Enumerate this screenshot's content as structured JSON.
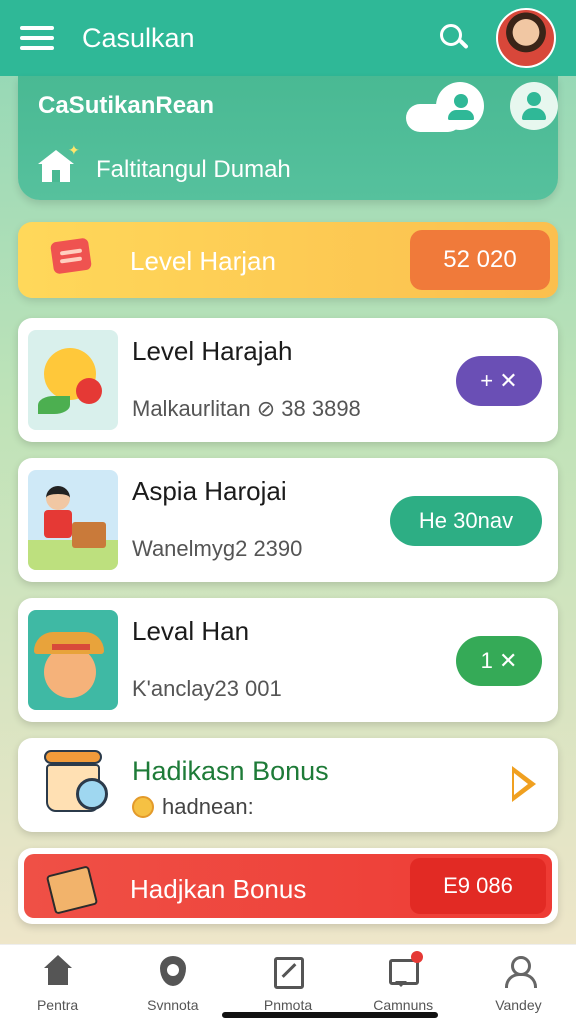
{
  "app": {
    "title": "Casulkan"
  },
  "header": {
    "title": "CaSutikanRean",
    "subtitle": "Faltitangul Dumah"
  },
  "level_banner": {
    "label": "Level Harjan",
    "value": "52 020"
  },
  "cards": [
    {
      "title": "Level Harajah",
      "subtitle": "Malkaurlitan ⊘ 38 3898",
      "action_label": "+ ✕",
      "action_color": "#6a4fb5"
    },
    {
      "title": "Aspia Harojai",
      "subtitle": "Wanelmyg2 2390",
      "action_label": "He 30nav",
      "action_color": "#2dae84"
    },
    {
      "title": "Leval Han",
      "subtitle": "K'anclay23 001",
      "action_label": "1 ✕",
      "action_color": "#35aa57"
    }
  ],
  "bonus_card": {
    "title": "Hadikasn Bonus",
    "subtitle": "hadnean:"
  },
  "red_banner": {
    "label": "Hadjkan Bonus",
    "value": "E9 086"
  },
  "bottom_nav": [
    {
      "label": "Pentra",
      "icon": "home-icon"
    },
    {
      "label": "Svnnota",
      "icon": "shield-icon"
    },
    {
      "label": "Pnmota",
      "icon": "edit-icon"
    },
    {
      "label": "Camnuns",
      "icon": "chat-icon"
    },
    {
      "label": "Vandey",
      "icon": "user-icon"
    }
  ],
  "colors": {
    "primary": "#2fb897",
    "accent_orange": "#f07a3a",
    "accent_red": "#ee3b34",
    "banner_yellow": "#ffd85a"
  }
}
